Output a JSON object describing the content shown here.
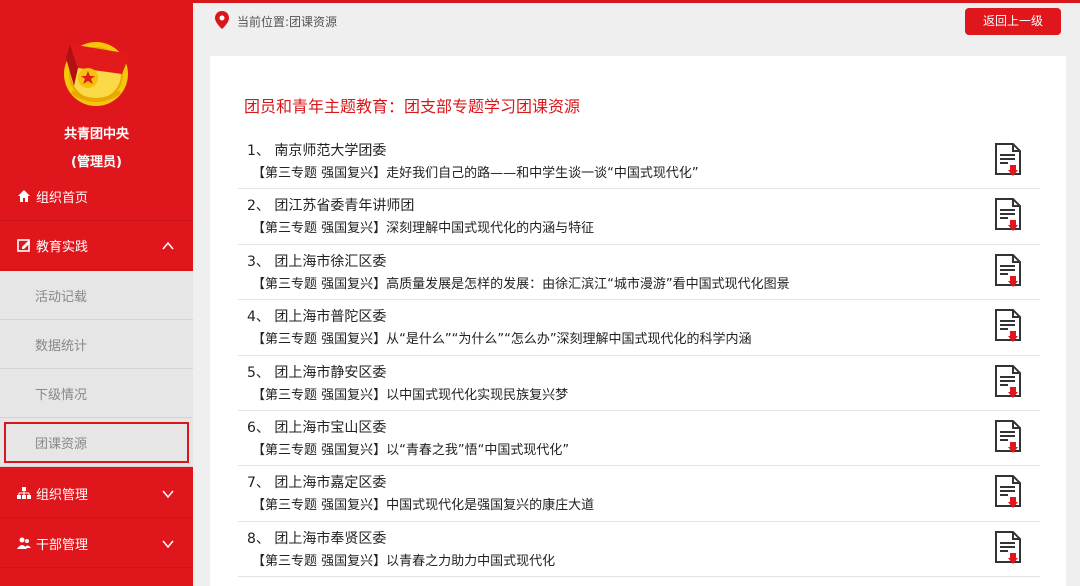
{
  "sidebar": {
    "org_name": "共青团中央",
    "org_role": "(管理员)",
    "items": [
      {
        "label": "组织首页",
        "icon": "home-icon"
      },
      {
        "label": "教育实践",
        "icon": "edit-icon",
        "expanded": true
      },
      {
        "label": "组织管理",
        "icon": "sitemap-icon",
        "expanded": false
      },
      {
        "label": "干部管理",
        "icon": "users-icon",
        "expanded": false
      }
    ],
    "sub_items": [
      "活动记载",
      "数据统计",
      "下级情况",
      "团课资源"
    ],
    "active_sub": "团课资源"
  },
  "header": {
    "location": "当前位置:团课资源",
    "back_label": "返回上一级"
  },
  "main": {
    "title": "团员和青年主题教育：团支部专题学习团课资源",
    "rows": [
      {
        "num": "1、",
        "org": "南京师范大学团委",
        "tag": "【第三专题 强国复兴】",
        "topic": "走好我们自己的路——和中学生谈一谈“中国式现代化”"
      },
      {
        "num": "2、",
        "org": "团江苏省委青年讲师团",
        "tag": "【第三专题 强国复兴】",
        "topic": "深刻理解中国式现代化的内涵与特征"
      },
      {
        "num": "3、",
        "org": "团上海市徐汇区委",
        "tag": "【第三专题 强国复兴】",
        "topic": "高质量发展是怎样的发展：由徐汇滨江“城市漫游”看中国式现代化图景"
      },
      {
        "num": "4、",
        "org": "团上海市普陀区委",
        "tag": "【第三专题 强国复兴】",
        "topic": "从“是什么”“为什么”“怎么办”深刻理解中国式现代化的科学内涵"
      },
      {
        "num": "5、",
        "org": "团上海市静安区委",
        "tag": "【第三专题 强国复兴】",
        "topic": "以中国式现代化实现民族复兴梦"
      },
      {
        "num": "6、",
        "org": "团上海市宝山区委",
        "tag": "【第三专题 强国复兴】",
        "topic": "以“青春之我”悟“中国式现代化”"
      },
      {
        "num": "7、",
        "org": "团上海市嘉定区委",
        "tag": "【第三专题 强国复兴】",
        "topic": "中国式现代化是强国复兴的康庄大道"
      },
      {
        "num": "8、",
        "org": "团上海市奉贤区委",
        "tag": "【第三专题 强国复兴】",
        "topic": "以青春之力助力中国式现代化"
      }
    ]
  },
  "colors": {
    "brand_red": "#e0161d",
    "title_red": "#d8171c",
    "sub_bg": "#e6e6e6"
  }
}
